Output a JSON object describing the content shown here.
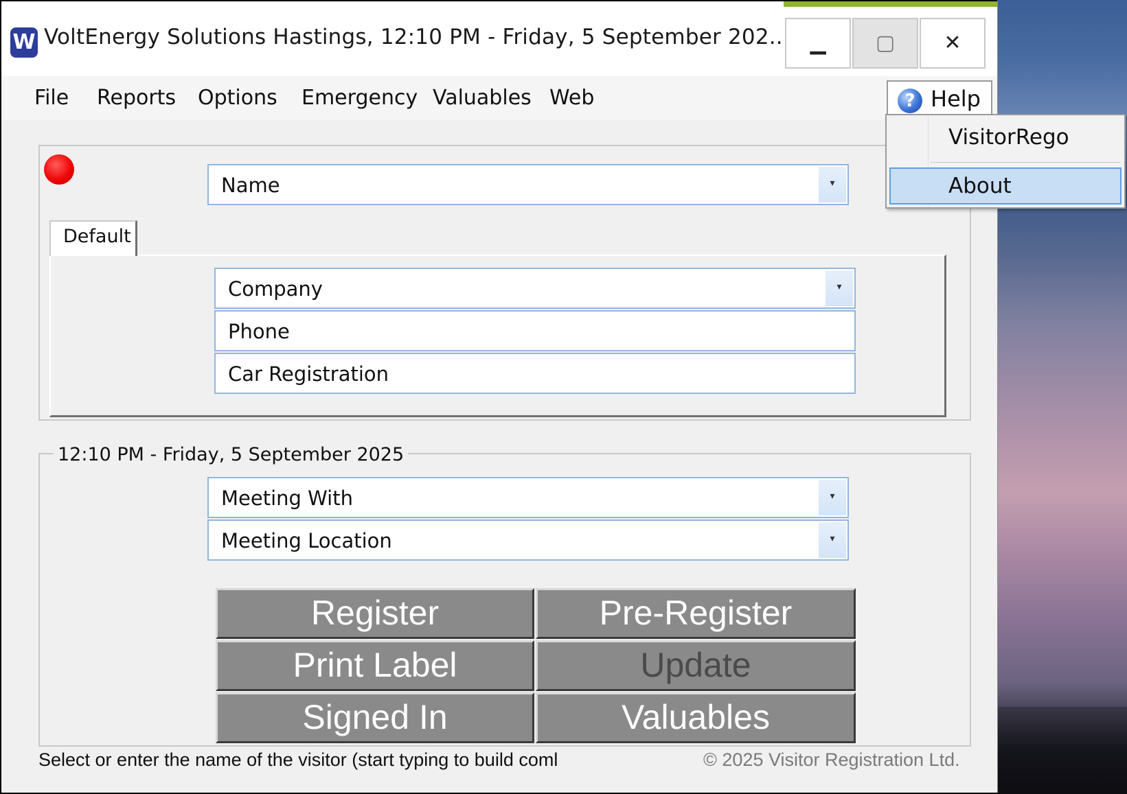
{
  "window": {
    "title": "VoltEnergy Solutions Hastings, 12:10 PM  -  Friday, 5 September 202...",
    "logo_glyph": "W",
    "minimize_glyph": "▁",
    "maximize_glyph": "▢",
    "close_glyph": "✕"
  },
  "menu": {
    "items": [
      "File",
      "Reports",
      "Options",
      "Emergency",
      "Valuables",
      "Web"
    ],
    "help": "Help",
    "help_icon_glyph": "?"
  },
  "help_dropdown": {
    "items": [
      "VisitorRego",
      "About"
    ],
    "highlighted": "About"
  },
  "status_indicator": {
    "color": "#ee0000"
  },
  "form": {
    "name": "Name",
    "tab": "Default",
    "company": "Company",
    "phone": "Phone",
    "car_registration": "Car Registration",
    "datetime_caption": "12:10 PM - Friday, 5 September 2025",
    "meeting_with": "Meeting With",
    "meeting_location": "Meeting Location",
    "combo_arrow_glyph": "▾"
  },
  "actions": {
    "register": "Register",
    "pre_register": "Pre-Register",
    "print_label": "Print Label",
    "update": "Update",
    "signed_in": "Signed In",
    "valuables": "Valuables"
  },
  "footer": {
    "status": "Select or enter the name of the visitor (start typing to build coml",
    "copyright": "© 2025 Visitor Registration Ltd."
  },
  "colors": {
    "accent": "#8db62c",
    "button_gray": "#8a8a8a",
    "highlight": "#c8def5"
  }
}
